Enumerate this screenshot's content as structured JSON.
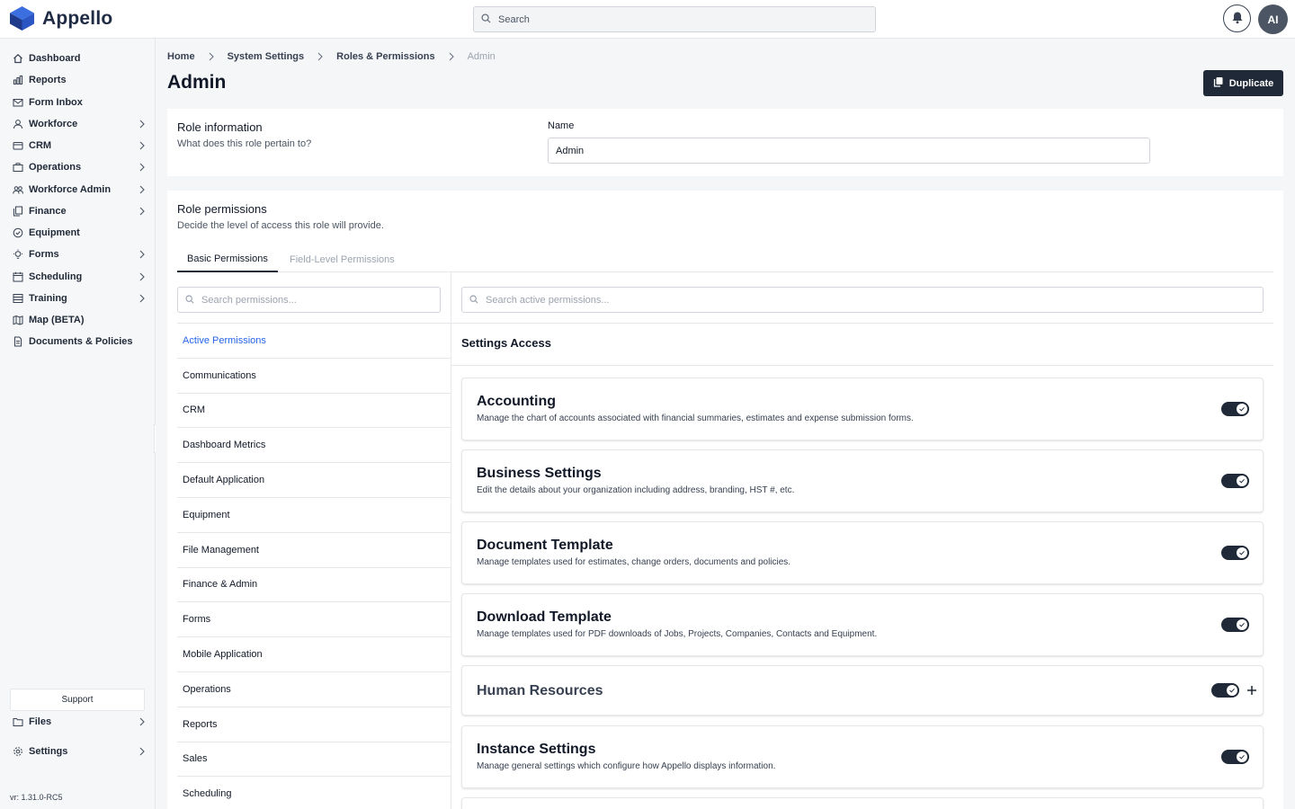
{
  "app": {
    "name": "Appello"
  },
  "search": {
    "placeholder": "Search"
  },
  "user": {
    "initials": "AI"
  },
  "sidebar": {
    "items": [
      {
        "label": "Dashboard",
        "icon": "home-icon",
        "has_children": false
      },
      {
        "label": "Reports",
        "icon": "bar-chart-icon",
        "has_children": false
      },
      {
        "label": "Form Inbox",
        "icon": "mail-icon",
        "has_children": false
      },
      {
        "label": "Workforce",
        "icon": "user-icon",
        "has_children": true
      },
      {
        "label": "CRM",
        "icon": "card-icon",
        "has_children": true
      },
      {
        "label": "Operations",
        "icon": "briefcase-icon",
        "has_children": true
      },
      {
        "label": "Workforce Admin",
        "icon": "users-icon",
        "has_children": true
      },
      {
        "label": "Finance",
        "icon": "copy-icon",
        "has_children": true
      },
      {
        "label": "Equipment",
        "icon": "check-circle-icon",
        "has_children": false
      },
      {
        "label": "Forms",
        "icon": "lightbulb-icon",
        "has_children": true
      },
      {
        "label": "Scheduling",
        "icon": "calendar-icon",
        "has_children": true
      },
      {
        "label": "Training",
        "icon": "list-icon",
        "has_children": true
      },
      {
        "label": "Map (BETA)",
        "icon": "map-icon",
        "has_children": false
      },
      {
        "label": "Documents & Policies",
        "icon": "document-icon",
        "has_children": false
      }
    ],
    "support_label": "Support",
    "files_label": "Files",
    "settings_label": "Settings",
    "version": "vr: 1.31.0-RC5"
  },
  "breadcrumb": [
    "Home",
    "System Settings",
    "Roles & Permissions",
    "Admin"
  ],
  "page": {
    "title": "Admin",
    "duplicate_label": "Duplicate"
  },
  "role_info": {
    "title": "Role information",
    "subtitle": "What does this role pertain to?",
    "name_label": "Name",
    "name_value": "Admin"
  },
  "role_permissions": {
    "title": "Role permissions",
    "subtitle": "Decide the level of access this role will provide.",
    "tabs": [
      "Basic Permissions",
      "Field-Level Permissions"
    ],
    "search_placeholder": "Search permissions...",
    "active_search_placeholder": "Search active permissions...",
    "categories": [
      "Active Permissions",
      "Communications",
      "CRM",
      "Dashboard Metrics",
      "Default Application",
      "Equipment",
      "File Management",
      "Finance & Admin",
      "Forms",
      "Mobile Application",
      "Operations",
      "Reports",
      "Sales",
      "Scheduling"
    ],
    "section_title": "Settings Access",
    "permissions": [
      {
        "name": "Accounting",
        "description": "Manage the chart of accounts associated with financial summaries, estimates and expense submission forms.",
        "enabled": true
      },
      {
        "name": "Business Settings",
        "description": "Edit the details about your organization including address, branding, HST #, etc.",
        "enabled": true
      },
      {
        "name": "Document Template",
        "description": "Manage templates used for estimates, change orders, documents and policies.",
        "enabled": true
      },
      {
        "name": "Download Template",
        "description": "Manage templates used for PDF downloads of Jobs, Projects, Companies, Contacts and Equipment.",
        "enabled": true
      },
      {
        "name": "Human Resources",
        "description": "",
        "enabled": true
      },
      {
        "name": "Instance Settings",
        "description": "Manage general settings which configure how Appello displays information.",
        "enabled": true
      }
    ]
  },
  "colors": {
    "brand": "#2563eb",
    "dark": "#1f2937",
    "link_active": "#2563eb"
  }
}
